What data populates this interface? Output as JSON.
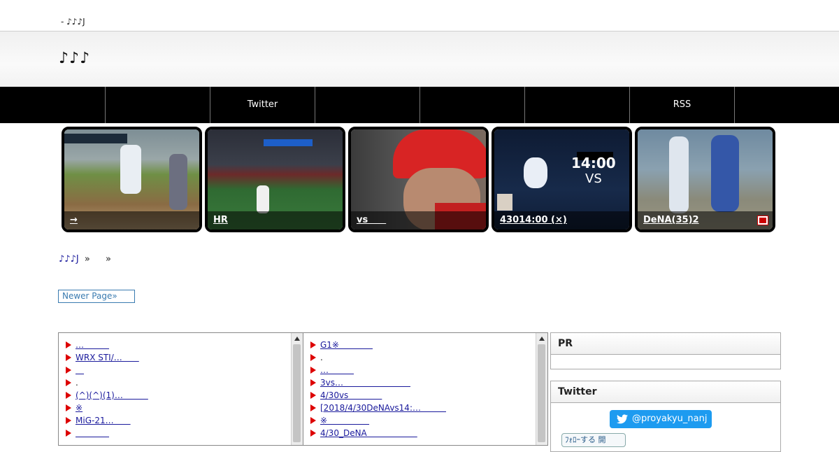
{
  "topbar": {
    "text": "- ♪♪♪J"
  },
  "header": {
    "site_title": "♪♪♪"
  },
  "nav": {
    "items": [
      "",
      "",
      "Twitter",
      "",
      "",
      "",
      "RSS"
    ]
  },
  "thumbs": [
    {
      "caption": "→",
      "icon": ""
    },
    {
      "caption": "HR",
      "icon": ""
    },
    {
      "caption": "vs　　",
      "icon": ""
    },
    {
      "caption": "43014:00 (×)",
      "icon": ""
    },
    {
      "caption": "DeNA(35)2",
      "icon": "flag-icon"
    }
  ],
  "breadcrumb": {
    "home": "♪♪♪J",
    "sep1": "»",
    "sep2": "»"
  },
  "pager": {
    "newer": "Newer Page»"
  },
  "list_left": {
    "items": [
      "…　　　",
      "WRX STI/…　　",
      "＿",
      ".",
      "(^)(^)(1)…　　　",
      "※",
      "MiG-21…　　",
      "　　　　"
    ]
  },
  "list_right": {
    "items": [
      "G1※　　　　",
      ".",
      "…　　　",
      "3vs…　　　　　　　　",
      "4/30vs　　　　",
      "[2018/4/30DeNAvs14:…　　　",
      "※　　　　　",
      "4/30_DeNA　　　　　　"
    ]
  },
  "sidebar": {
    "pr_title": "PR",
    "twitter_title": "Twitter",
    "twitter_handle": "@proyakyu_nanj",
    "follow_label": "ﾌｫﾛｰする 開"
  },
  "colors": {
    "accent_blue": "#1d9bf0",
    "link": "#1a1a9c",
    "triangle": "#dd0000"
  }
}
